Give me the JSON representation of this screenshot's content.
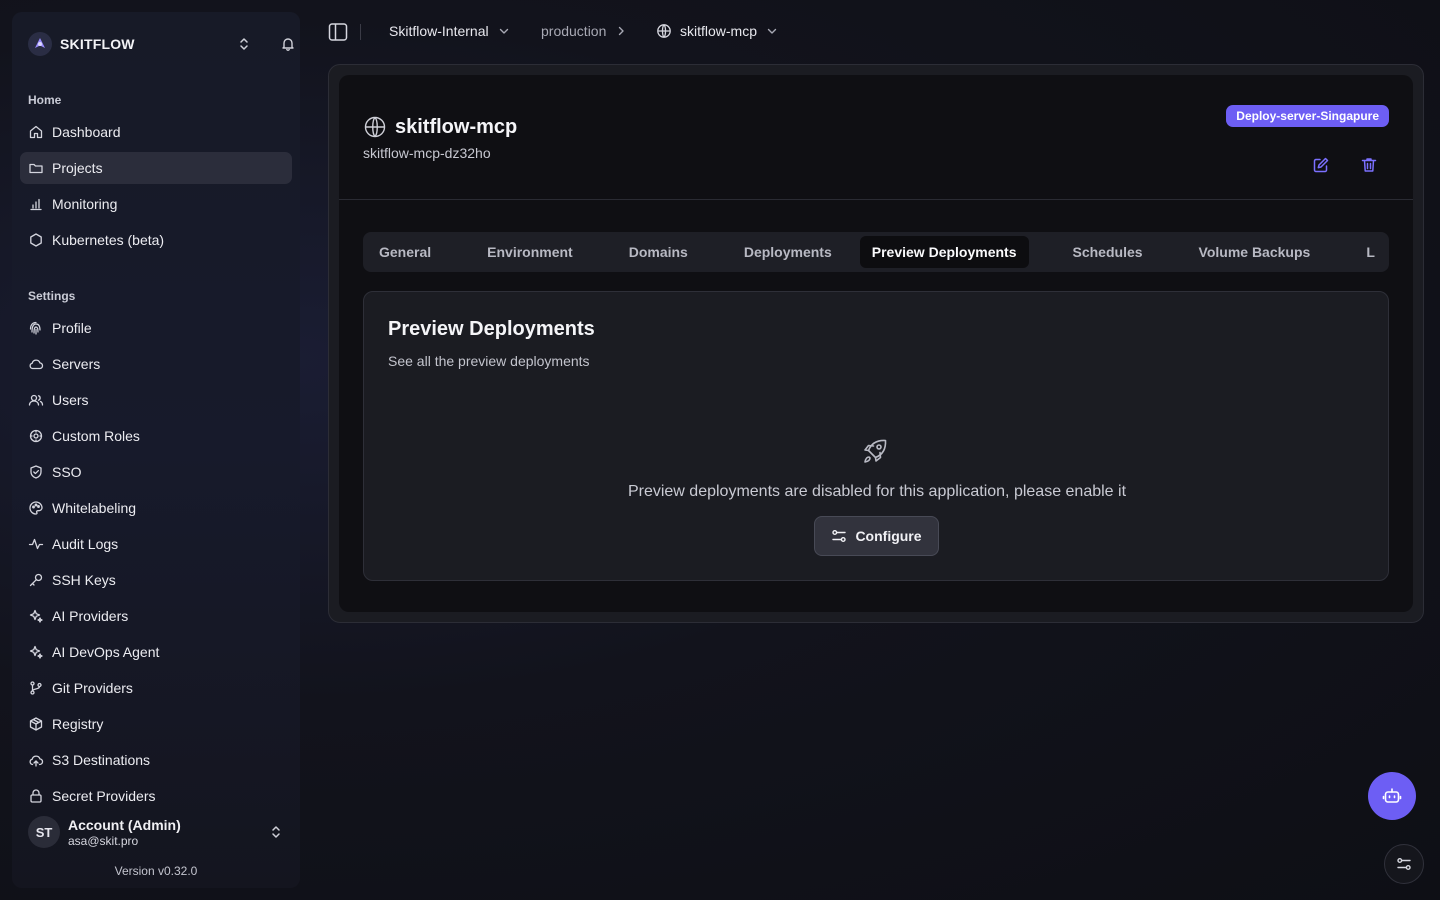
{
  "brand": {
    "name": "SKITFLOW"
  },
  "sidebar": {
    "home_label": "Home",
    "home_items": [
      {
        "label": "Dashboard",
        "icon": "home-icon"
      },
      {
        "label": "Projects",
        "icon": "folder-icon",
        "active": true
      },
      {
        "label": "Monitoring",
        "icon": "bar-chart-icon"
      },
      {
        "label": "Kubernetes (beta)",
        "icon": "hexagon-icon"
      }
    ],
    "settings_label": "Settings",
    "settings_items": [
      {
        "label": "Profile",
        "icon": "fingerprint-icon"
      },
      {
        "label": "Servers",
        "icon": "cloud-icon"
      },
      {
        "label": "Users",
        "icon": "users-icon"
      },
      {
        "label": "Custom Roles",
        "icon": "shield-cog-icon"
      },
      {
        "label": "SSO",
        "icon": "shield-check-icon"
      },
      {
        "label": "Whitelabeling",
        "icon": "palette-icon"
      },
      {
        "label": "Audit Logs",
        "icon": "activity-icon"
      },
      {
        "label": "SSH Keys",
        "icon": "key-icon"
      },
      {
        "label": "AI Providers",
        "icon": "sparkles-icon"
      },
      {
        "label": "AI DevOps Agent",
        "icon": "sparkles-icon"
      },
      {
        "label": "Git Providers",
        "icon": "git-branch-icon"
      },
      {
        "label": "Registry",
        "icon": "package-icon"
      },
      {
        "label": "S3 Destinations",
        "icon": "cloud-upload-icon"
      },
      {
        "label": "Secret Providers",
        "icon": "lock-icon"
      }
    ],
    "account": {
      "initials": "ST",
      "name": "Account (Admin)",
      "email": "asa@skit.pro"
    },
    "version": "Version v0.32.0"
  },
  "topbar": {
    "organization": "Skitflow-Internal",
    "environment": "production",
    "service": "skitflow-mcp"
  },
  "app": {
    "title": "skitflow-mcp",
    "app_name": "skitflow-mcp-dz32ho",
    "server_badge": "Deploy-server-Singapure"
  },
  "tabs": [
    {
      "label": "General"
    },
    {
      "label": "Environment"
    },
    {
      "label": "Domains"
    },
    {
      "label": "Deployments"
    },
    {
      "label": "Preview Deployments",
      "active": true
    },
    {
      "label": "Schedules"
    },
    {
      "label": "Volume Backups"
    },
    {
      "label": "L"
    }
  ],
  "panel": {
    "title": "Preview Deployments",
    "description": "See all the preview deployments",
    "empty_message": "Preview deployments are disabled for this application, please enable it",
    "configure_label": "Configure"
  },
  "colors": {
    "accent": "#6d5ef4",
    "background": "#0f0f13",
    "active_nav": "#2b2d3b"
  }
}
